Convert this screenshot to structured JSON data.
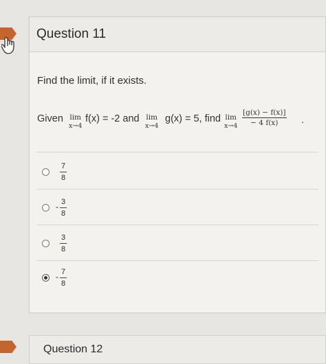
{
  "question": {
    "title": "Question 11",
    "instruction": "Find the limit, if it exists.",
    "statement": {
      "given": "Given",
      "lim": "lim",
      "approach": "x→4",
      "f_clause": "f(x) = -2 and",
      "g_clause": "g(x) = 5, find",
      "numerator": "[g(x) − f(x)]",
      "denominator": "− 4 f(x)",
      "end": "."
    },
    "options": [
      {
        "sign": "",
        "numerator": "7",
        "denominator": "8",
        "selected": false
      },
      {
        "sign": "-",
        "numerator": "3",
        "denominator": "8",
        "selected": false
      },
      {
        "sign": "",
        "numerator": "3",
        "denominator": "8",
        "selected": false
      },
      {
        "sign": "-",
        "numerator": "7",
        "denominator": "8",
        "selected": true
      }
    ]
  },
  "next_question": {
    "title": "Question 12"
  },
  "colors": {
    "flag": "#c4642f",
    "card_bg": "#f3f2ef",
    "page_bg": "#e7e6e3"
  },
  "icons": [
    "flag-icon",
    "hand-cursor-icon",
    "radio-button-icon"
  ]
}
